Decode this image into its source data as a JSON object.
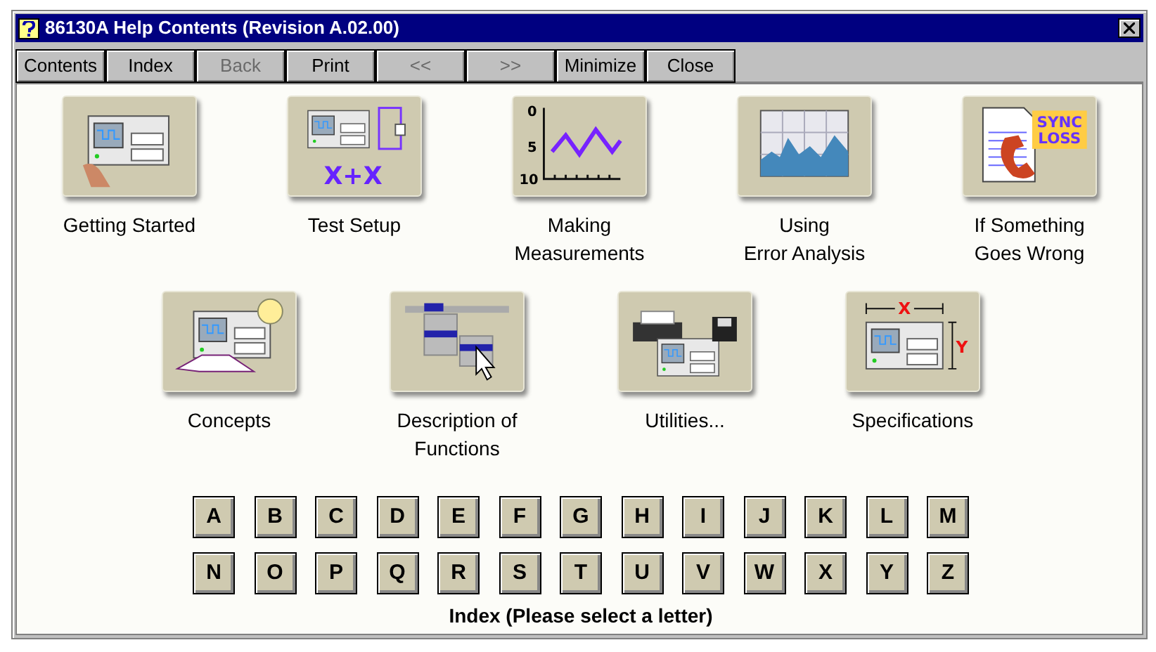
{
  "window": {
    "title": "86130A Help Contents (Revision A.02.00)"
  },
  "toolbar": [
    {
      "label": "Contents",
      "disabled": false
    },
    {
      "label": "Index",
      "disabled": false
    },
    {
      "label": "Back",
      "disabled": true
    },
    {
      "label": "Print",
      "disabled": false
    },
    {
      "label": "<<",
      "disabled": true
    },
    {
      "label": ">>",
      "disabled": true
    },
    {
      "label": "Minimize",
      "disabled": false
    },
    {
      "label": "Close",
      "disabled": false
    }
  ],
  "topics_row_1": [
    {
      "kind": "instrument",
      "label": [
        "Getting Started"
      ]
    },
    {
      "kind": "setup",
      "label": [
        "Test Setup"
      ],
      "icon_text": [
        "X+X"
      ]
    },
    {
      "kind": "graph",
      "label": [
        "Making",
        "Measurements"
      ],
      "icon_text": [
        "0",
        "5",
        "10"
      ]
    },
    {
      "kind": "analysis",
      "label": [
        "Using",
        "Error Analysis"
      ]
    },
    {
      "kind": "sync",
      "label": [
        "If Something",
        "Goes Wrong"
      ],
      "icon_text": [
        "SYNC",
        "LOSS"
      ]
    }
  ],
  "topics_row_2": [
    {
      "kind": "concepts",
      "label": [
        "Concepts"
      ]
    },
    {
      "kind": "functions",
      "label": [
        "Description of",
        "Functions"
      ]
    },
    {
      "kind": "utilities",
      "label": [
        "Utilities..."
      ]
    },
    {
      "kind": "specifications",
      "label": [
        "Specifications"
      ],
      "icon_text": [
        "X",
        "Y"
      ]
    }
  ],
  "letters_row_1": [
    "A",
    "B",
    "C",
    "D",
    "E",
    "F",
    "G",
    "H",
    "I",
    "J",
    "K",
    "L",
    "M"
  ],
  "letters_row_2": [
    "N",
    "O",
    "P",
    "Q",
    "R",
    "S",
    "T",
    "U",
    "V",
    "W",
    "X",
    "Y",
    "Z"
  ],
  "index_caption": "Index (Please select a letter)"
}
